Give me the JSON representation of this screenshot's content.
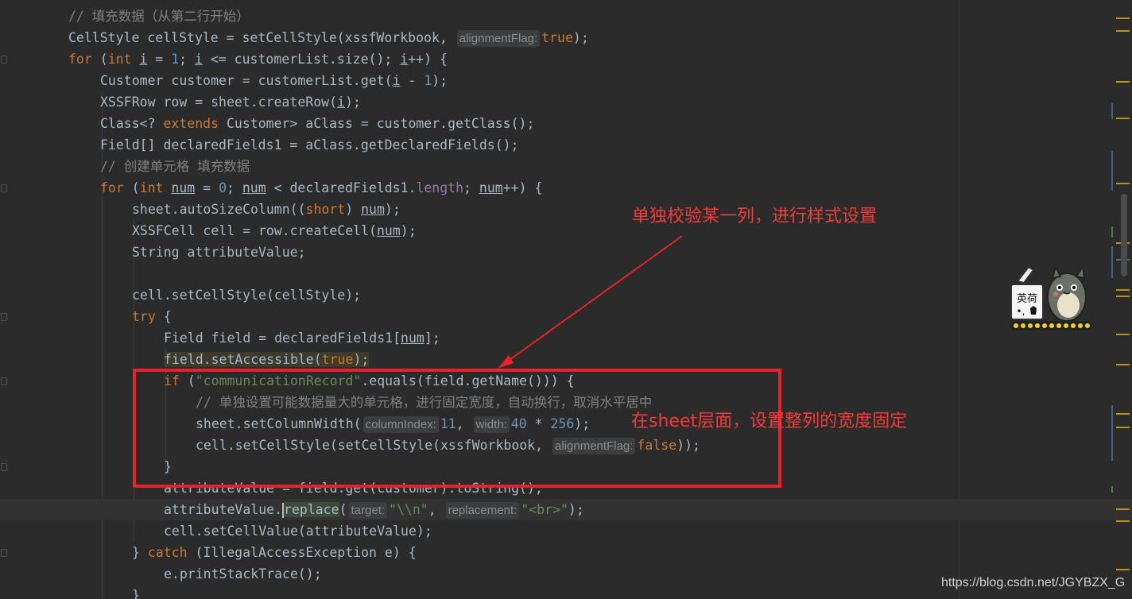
{
  "code": {
    "l1_comment": "// 填充数据（从第二行开始）",
    "l2_a": "CellStyle cellStyle = setCellStyle(xssfWorkbook, ",
    "l2_hint": "alignmentFlag:",
    "l2_b": "true",
    "l2_c": ");",
    "l3_for": "for",
    "l3_a": " (",
    "l3_int": "int",
    "l3_b": " ",
    "l3_i1": "i",
    "l3_c": " = ",
    "l3_one": "1",
    "l3_d": "; ",
    "l3_i2": "i",
    "l3_e": " <= customerList.size(); ",
    "l3_i3": "i",
    "l3_f": "++) {",
    "l4_a": "Customer customer = customerList.get(",
    "l4_i": "i",
    "l4_b": " - ",
    "l4_one": "1",
    "l4_c": ");",
    "l5_a": "XSSFRow row = sheet.createRow(",
    "l5_i": "i",
    "l5_b": ");",
    "l6_a": "Class<? ",
    "l6_kw": "extends",
    "l6_b": " Customer> aClass = customer.getClass();",
    "l7": "Field[] declaredFields1 = aClass.getDeclaredFields();",
    "l8_comment": "// 创建单元格 填充数据",
    "l9_for": "for",
    "l9_a": " (",
    "l9_int": "int",
    "l9_b": " ",
    "l9_num1": "num",
    "l9_c": " = ",
    "l9_zero": "0",
    "l9_d": "; ",
    "l9_num2": "num",
    "l9_e": " < declaredFields1.",
    "l9_length": "length",
    "l9_f": "; ",
    "l9_num3": "num",
    "l9_g": "++) {",
    "l10_a": "sheet.autoSizeColumn((",
    "l10_kw": "short",
    "l10_b": ") ",
    "l10_num": "num",
    "l10_c": ");",
    "l11_a": "XSSFCell cell = row.createCell(",
    "l11_num": "num",
    "l11_b": ");",
    "l12": "String attributeValue;",
    "l14": "cell.setCellStyle(cellStyle);",
    "l15_try": "try",
    "l15_b": " {",
    "l16_a": "Field field = declaredFields1[",
    "l16_num": "num",
    "l16_b": "];",
    "l17_a": "field.setAccessible(",
    "l17_true": "true",
    "l17_b": ");",
    "l18_if": "if",
    "l18_a": " (",
    "l18_str": "\"communicationRecord\"",
    "l18_b": ".equals(field.getName())) {",
    "l19_comment": "// 单独设置可能数据量大的单元格，进行固定宽度，自动换行，取消水平居中",
    "l20_a": "sheet.setColumnWidth(",
    "l20_hint1": "columnIndex:",
    "l20_n1": "11",
    "l20_b": ", ",
    "l20_hint2": "width:",
    "l20_n2": "40",
    "l20_c": " * ",
    "l20_n3": "256",
    "l20_d": ");",
    "l21_a": "cell.setCellStyle(setCellStyle(xssfWorkbook, ",
    "l21_hint": "alignmentFlag:",
    "l21_false": "false",
    "l21_b": "));",
    "l22": "}",
    "l23": "attributeValue = field.get(customer).toString();",
    "l24_a": "attributeValue.",
    "l24_b": "replace",
    "l24_c": "(",
    "l24_hint1": "target:",
    "l24_s1": "\"\\\\n\"",
    "l24_d": ", ",
    "l24_hint2": "replacement:",
    "l24_s2": "\"<br>\"",
    "l24_e": ");",
    "l25": "cell.setCellValue(attributeValue);",
    "l26_a": "} ",
    "l26_catch": "catch",
    "l26_b": " (IllegalAccessException e) {",
    "l27": "e.printStackTrace();",
    "l28": "}"
  },
  "annotations": {
    "top": "单独校验某一列，进行样式设置",
    "side": "在sheet层面，设置整列的宽度固定"
  },
  "plugin": {
    "label_top": "英荷",
    "label_bottom": "•,"
  },
  "watermark": "https://blog.csdn.net/JGYBZX_G",
  "colors": {
    "background": "#2b2b2b",
    "keyword": "#cc7832",
    "number": "#6897bb",
    "string": "#6a8759",
    "comment": "#808080",
    "annotation": "#f33a3a",
    "box": "#e8212d"
  }
}
